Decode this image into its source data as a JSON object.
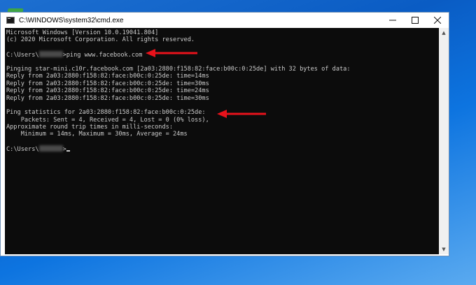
{
  "window": {
    "title": "C:\\WINDOWS\\system32\\cmd.exe",
    "minimize_icon": "minimize-icon",
    "maximize_icon": "maximize-icon",
    "close_icon": "close-icon"
  },
  "console": {
    "lines": [
      {
        "text": "Microsoft Windows [Version 10.0.19041.804]"
      },
      {
        "text": "(c) 2020 Microsoft Corporation. All rights reserved."
      },
      {
        "text": ""
      },
      {
        "prefix": "C:\\Users\\",
        "redacted": true,
        "suffix": ">ping www.facebook.com"
      },
      {
        "text": ""
      },
      {
        "text": "Pinging star-mini.c10r.facebook.com [2a03:2880:f158:82:face:b00c:0:25de] with 32 bytes of data:"
      },
      {
        "text": "Reply from 2a03:2880:f158:82:face:b00c:0:25de: time=14ms"
      },
      {
        "text": "Reply from 2a03:2880:f158:82:face:b00c:0:25de: time=30ms"
      },
      {
        "text": "Reply from 2a03:2880:f158:82:face:b00c:0:25de: time=24ms"
      },
      {
        "text": "Reply from 2a03:2880:f158:82:face:b00c:0:25de: time=30ms"
      },
      {
        "text": ""
      },
      {
        "text": "Ping statistics for 2a03:2880:f158:82:face:b00c:0:25de:"
      },
      {
        "text": "    Packets: Sent = 4, Received = 4, Lost = 0 (0% loss),"
      },
      {
        "text": "Approximate round trip times in milli-seconds:"
      },
      {
        "text": "    Minimum = 14ms, Maximum = 30ms, Average = 24ms"
      },
      {
        "text": ""
      },
      {
        "prefix": "C:\\Users\\",
        "redacted": true,
        "suffix": ">",
        "cursor": true
      }
    ]
  },
  "annotations": {
    "arrow_color": "#e8121b"
  },
  "colors": {
    "console_bg": "#0c0c0c",
    "console_text": "#cccccc"
  }
}
